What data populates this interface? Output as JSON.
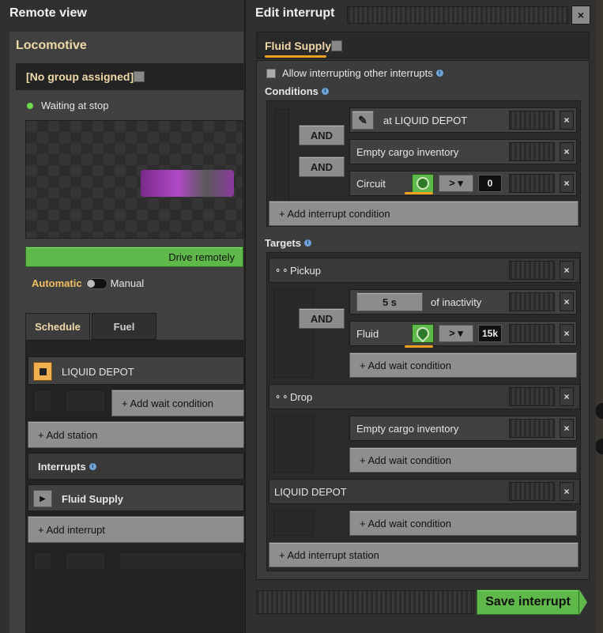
{
  "left": {
    "title": "Remote view",
    "subtitle": "Locomotive",
    "group": "[No group assigned]",
    "status": "Waiting at stop",
    "drive_button": "Drive remotely",
    "mode_automatic": "Automatic",
    "mode_manual": "Manual",
    "tabs": [
      "Schedule",
      "Fuel"
    ],
    "station_name": "LIQUID DEPOT",
    "add_wait_condition": "+ Add wait condition",
    "add_station": "+ Add station",
    "interrupts_label": "Interrupts",
    "interrupt_name": "Fluid Supply",
    "add_interrupt": "+ Add interrupt"
  },
  "right": {
    "title": "Edit interrupt",
    "interrupt_name": "Fluid Supply",
    "allow_interrupting": "Allow interrupting other interrupts",
    "conditions_label": "Conditions",
    "and_label": "AND",
    "conditions": [
      {
        "text": "at LIQUID DEPOT"
      },
      {
        "text": "Empty cargo inventory"
      },
      {
        "text": "Circuit",
        "compare": ">",
        "value": "0"
      }
    ],
    "add_interrupt_condition": "+ Add interrupt condition",
    "targets_label": "Targets",
    "targets": [
      {
        "name": "Pickup",
        "inactivity_value": "5 s",
        "inactivity_text": "of inactivity",
        "fluid_label": "Fluid",
        "compare": ">",
        "value": "15k"
      },
      {
        "name": "Drop",
        "condition": "Empty cargo inventory"
      },
      {
        "name": "LIQUID DEPOT"
      }
    ],
    "add_wait_condition": "+ Add wait condition",
    "add_interrupt_station": "+ Add interrupt station",
    "save_button": "Save interrupt",
    "close_label": "×"
  },
  "colors": {
    "accent": "#f0a020",
    "green": "#5fb94a",
    "panel": "#313031"
  }
}
